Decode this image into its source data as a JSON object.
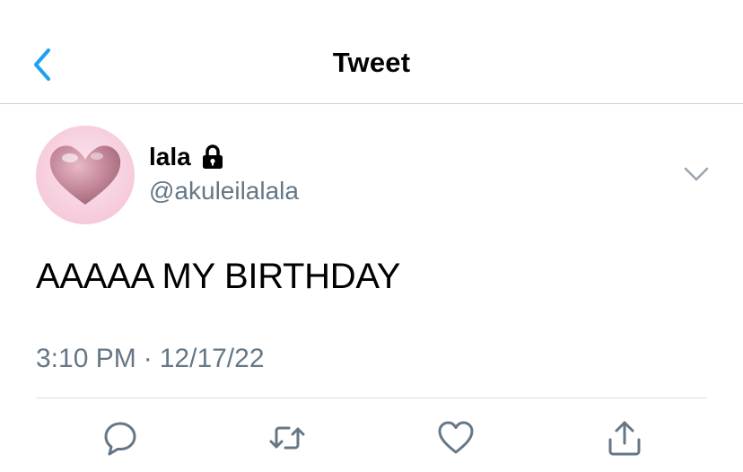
{
  "nav": {
    "title": "Tweet"
  },
  "tweet": {
    "display_name": "lala",
    "handle": "@akuleilalala",
    "text": "AAAAA MY BIRTHDAY",
    "time": "3:10 PM",
    "separator": "·",
    "date": "12/17/22"
  },
  "icons": {
    "back": "chevron-left-icon",
    "lock": "lock-icon",
    "more": "chevron-down-icon",
    "reply": "reply-icon",
    "retweet": "retweet-icon",
    "like": "heart-icon",
    "share": "share-icon"
  },
  "colors": {
    "accent": "#1DA1F2",
    "secondary_text": "#657786",
    "action_icon": "#657786"
  }
}
